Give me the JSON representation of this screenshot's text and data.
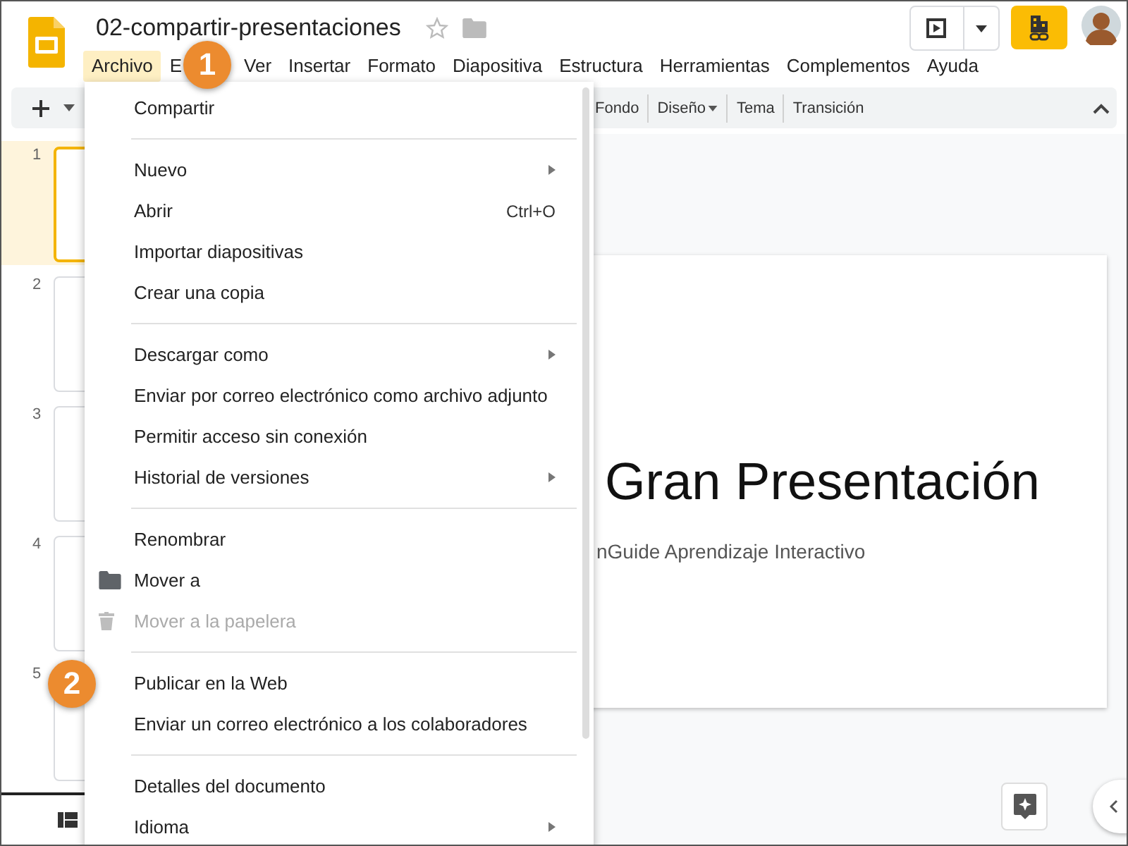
{
  "document": {
    "title": "02-compartir-presentaciones"
  },
  "menubar": [
    {
      "label": "Archivo",
      "selected": true
    },
    {
      "label": "E",
      "selected": false
    },
    {
      "label": "Ver",
      "selected": false
    },
    {
      "label": "Insertar",
      "selected": false
    },
    {
      "label": "Formato",
      "selected": false
    },
    {
      "label": "Diapositiva",
      "selected": false
    },
    {
      "label": "Estructura",
      "selected": false
    },
    {
      "label": "Herramientas",
      "selected": false
    },
    {
      "label": "Complementos",
      "selected": false
    },
    {
      "label": "Ayuda",
      "selected": false
    }
  ],
  "toolbar": [
    {
      "label": "Fondo",
      "dropdown": false
    },
    {
      "label": "Diseño",
      "dropdown": true
    },
    {
      "label": "Tema",
      "dropdown": false
    },
    {
      "label": "Transición",
      "dropdown": false
    }
  ],
  "slides": [
    {
      "number": "1",
      "selected": true
    },
    {
      "number": "2",
      "selected": false
    },
    {
      "number": "3",
      "selected": false
    },
    {
      "number": "4",
      "selected": false
    },
    {
      "number": "5",
      "selected": false
    }
  ],
  "file_menu": [
    {
      "kind": "item",
      "label": "Compartir",
      "disabled": false,
      "submenu": false
    },
    {
      "kind": "divider"
    },
    {
      "kind": "item",
      "label": "Nuevo",
      "disabled": false,
      "submenu": true
    },
    {
      "kind": "item",
      "label": "Abrir",
      "disabled": false,
      "submenu": false,
      "shortcut": "Ctrl+O"
    },
    {
      "kind": "item",
      "label": "Importar diapositivas",
      "disabled": false,
      "submenu": false
    },
    {
      "kind": "item",
      "label": "Crear una copia",
      "disabled": false,
      "submenu": false
    },
    {
      "kind": "divider"
    },
    {
      "kind": "item",
      "label": "Descargar como",
      "disabled": false,
      "submenu": true
    },
    {
      "kind": "item",
      "label": "Enviar por correo electrónico como archivo adjunto",
      "disabled": false,
      "submenu": false
    },
    {
      "kind": "item",
      "label": "Permitir acceso sin conexión",
      "disabled": false,
      "submenu": false
    },
    {
      "kind": "item",
      "label": "Historial de versiones",
      "disabled": false,
      "submenu": true
    },
    {
      "kind": "divider"
    },
    {
      "kind": "item",
      "label": "Renombrar",
      "disabled": false,
      "submenu": false
    },
    {
      "kind": "folder",
      "label": "Mover a",
      "disabled": false,
      "submenu": false
    },
    {
      "kind": "trash",
      "label": "Mover a la papelera",
      "disabled": true,
      "submenu": false
    },
    {
      "kind": "divider"
    },
    {
      "kind": "item",
      "label": "Publicar en la Web",
      "disabled": false,
      "submenu": false
    },
    {
      "kind": "item",
      "label": "Enviar un correo electrónico a los colaboradores",
      "disabled": false,
      "submenu": false
    },
    {
      "kind": "divider"
    },
    {
      "kind": "item",
      "label": "Detalles del documento",
      "disabled": false,
      "submenu": false
    },
    {
      "kind": "item",
      "label": "Idioma",
      "disabled": false,
      "submenu": true
    }
  ],
  "slide": {
    "title": "Gran Presentación",
    "subtitle": "nGuide Aprendizaje Interactivo"
  },
  "callouts": [
    "1",
    "2"
  ]
}
